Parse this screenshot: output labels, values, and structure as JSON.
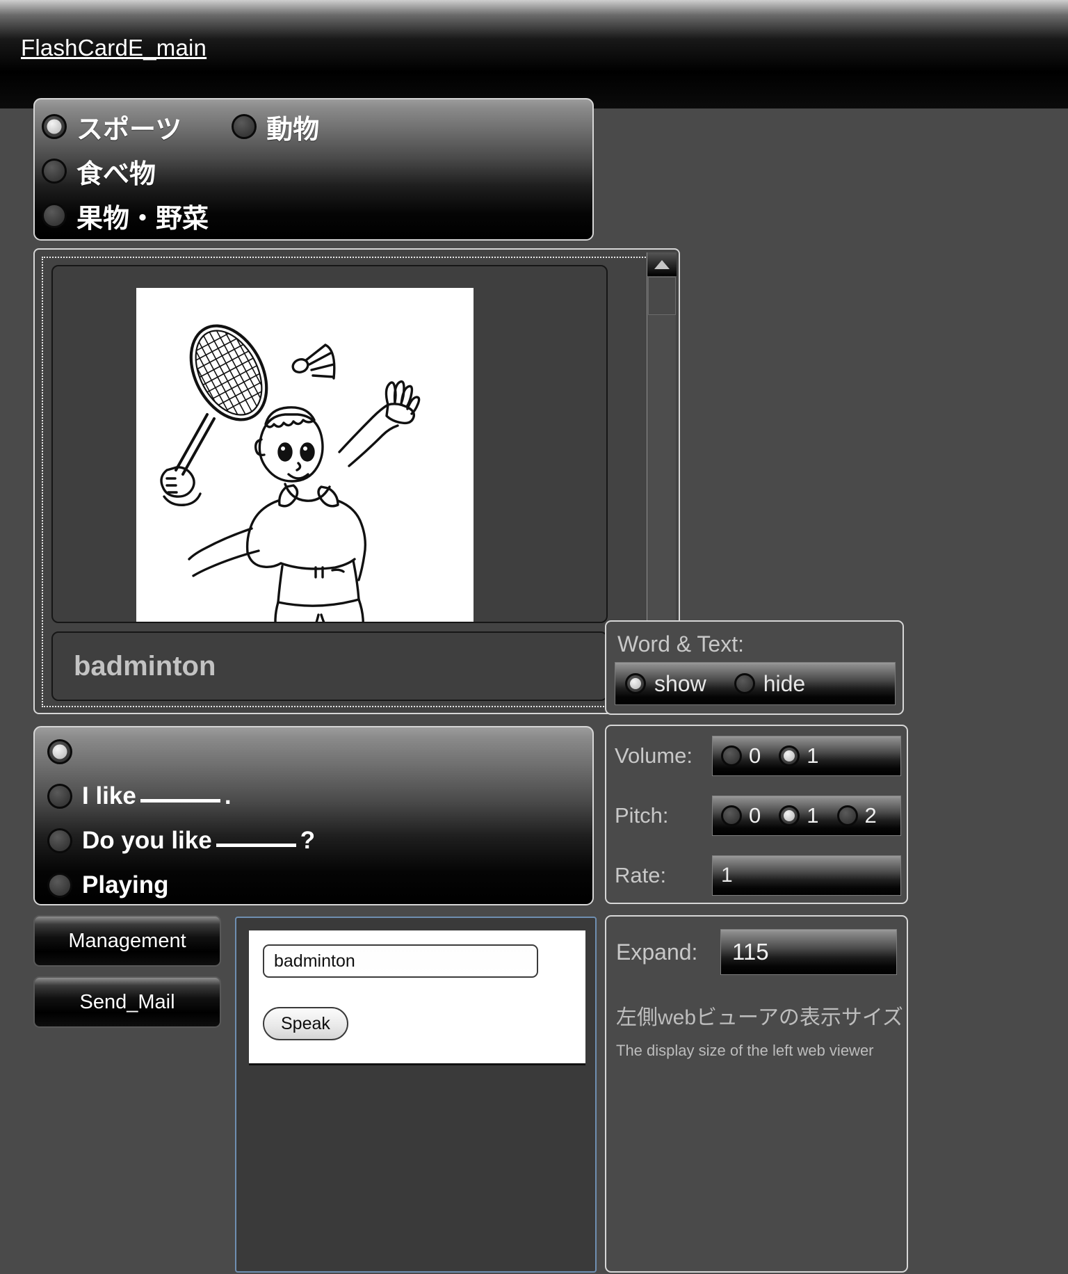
{
  "header": {
    "title": "FlashCardE_main"
  },
  "categories": {
    "items": [
      {
        "label": "スポーツ",
        "selected": true
      },
      {
        "label": "動物",
        "selected": false
      },
      {
        "label": "食べ物",
        "selected": false
      },
      {
        "label": "果物・野菜",
        "selected": false
      }
    ]
  },
  "card": {
    "image_name": "badminton-illustration",
    "word": "badminton"
  },
  "scrollbar": {
    "up_icon": "triangle-up-icon",
    "down_icon": "triangle-down-icon"
  },
  "sentences": {
    "items": [
      {
        "pre": "",
        "post": "",
        "blank": false,
        "selected": true
      },
      {
        "pre": "I like",
        "post": ".",
        "blank": true,
        "selected": false
      },
      {
        "pre": "Do you like",
        "post": "?",
        "blank": true,
        "selected": false
      },
      {
        "pre": "Playing",
        "post": "",
        "blank": false,
        "selected": false
      }
    ]
  },
  "buttons": {
    "management": "Management",
    "send_mail": "Send_Mail"
  },
  "speak_panel": {
    "input_value": "badminton",
    "input_placeholder": "",
    "button_label": "Speak"
  },
  "word_text": {
    "label": "Word & Text:",
    "options": [
      {
        "label": "show",
        "selected": true
      },
      {
        "label": "hide",
        "selected": false
      }
    ]
  },
  "speech": {
    "volume": {
      "label": "Volume:",
      "options": [
        {
          "label": "0",
          "selected": false
        },
        {
          "label": "1",
          "selected": true
        }
      ]
    },
    "pitch": {
      "label": "Pitch:",
      "options": [
        {
          "label": "0",
          "selected": false
        },
        {
          "label": "1",
          "selected": true
        },
        {
          "label": "2",
          "selected": false
        }
      ]
    },
    "rate": {
      "label": "Rate:",
      "value": "1"
    }
  },
  "expand": {
    "label": "Expand:",
    "value": "115",
    "note_jp": "左側webビューアの表示サイズ",
    "note_en": "The display size of the left web viewer"
  },
  "colors": {
    "page_background": "#4a4a4a",
    "panel_border": "#d7d7d7",
    "label_text": "#c8c8c8",
    "value_text": "#f0f0f0",
    "card_background": "#ffffff",
    "speak_frame_border": "#6f8fb2"
  }
}
